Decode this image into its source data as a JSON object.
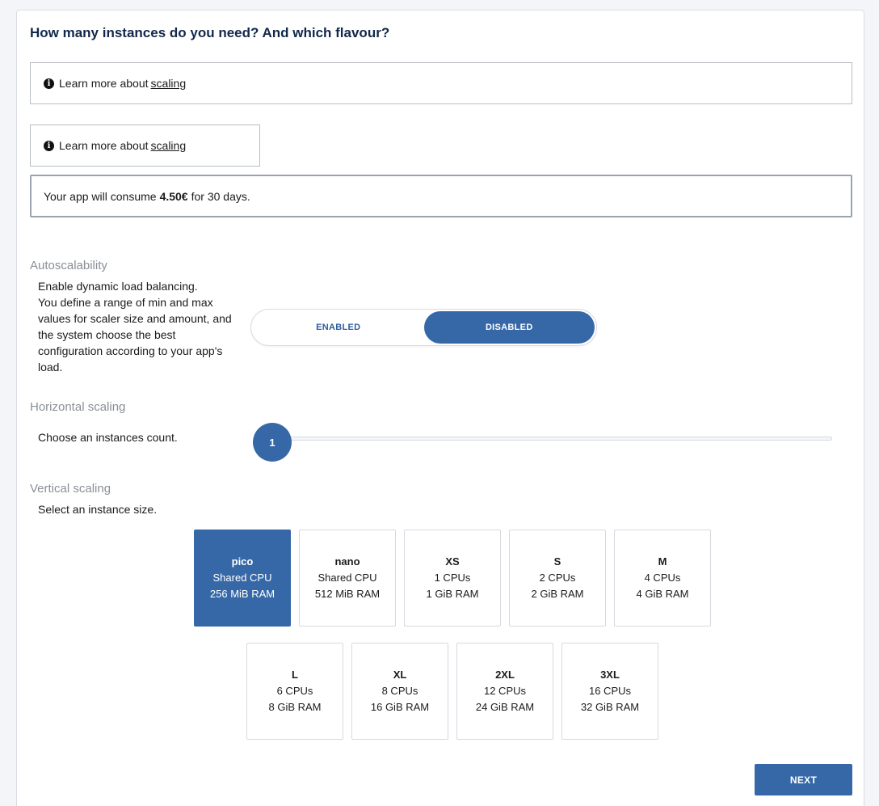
{
  "title": "How many instances do you need? And which flavour?",
  "info_wide": {
    "text": "Learn more about",
    "link": "scaling"
  },
  "info_narrow": {
    "text": "Learn more about",
    "link": "scaling"
  },
  "consume": {
    "prefix": "Your app will consume",
    "amount": "4.50€",
    "suffix": "for 30 days."
  },
  "autoscalability": {
    "label": "Autoscalability",
    "description": [
      "Enable dynamic load balancing.",
      "You define a range of min and max",
      "values for scaler size and amount, and",
      "the system choose the best",
      "configuration according to your app's",
      "load."
    ],
    "options": [
      "ENABLED",
      "DISABLED"
    ],
    "selected": "DISABLED"
  },
  "horizontal": {
    "label": "Horizontal scaling",
    "description": "Choose an instances count.",
    "value": "1"
  },
  "vertical": {
    "label": "Vertical scaling",
    "description": "Select an instance size.",
    "selected": "pico",
    "sizes": [
      {
        "name": "pico",
        "cpu": "Shared CPU",
        "ram": "256 MiB RAM"
      },
      {
        "name": "nano",
        "cpu": "Shared CPU",
        "ram": "512 MiB RAM"
      },
      {
        "name": "XS",
        "cpu": "1 CPUs",
        "ram": "1 GiB RAM"
      },
      {
        "name": "S",
        "cpu": "2 CPUs",
        "ram": "2 GiB RAM"
      },
      {
        "name": "M",
        "cpu": "4 CPUs",
        "ram": "4 GiB RAM"
      },
      {
        "name": "L",
        "cpu": "6 CPUs",
        "ram": "8 GiB RAM"
      },
      {
        "name": "XL",
        "cpu": "8 CPUs",
        "ram": "16 GiB RAM"
      },
      {
        "name": "2XL",
        "cpu": "12 CPUs",
        "ram": "24 GiB RAM"
      },
      {
        "name": "3XL",
        "cpu": "16 CPUs",
        "ram": "32 GiB RAM"
      }
    ]
  },
  "next_label": "NEXT",
  "colors": {
    "accent": "#3668a8",
    "title": "#12284b",
    "muted_label": "#8a8f96"
  }
}
